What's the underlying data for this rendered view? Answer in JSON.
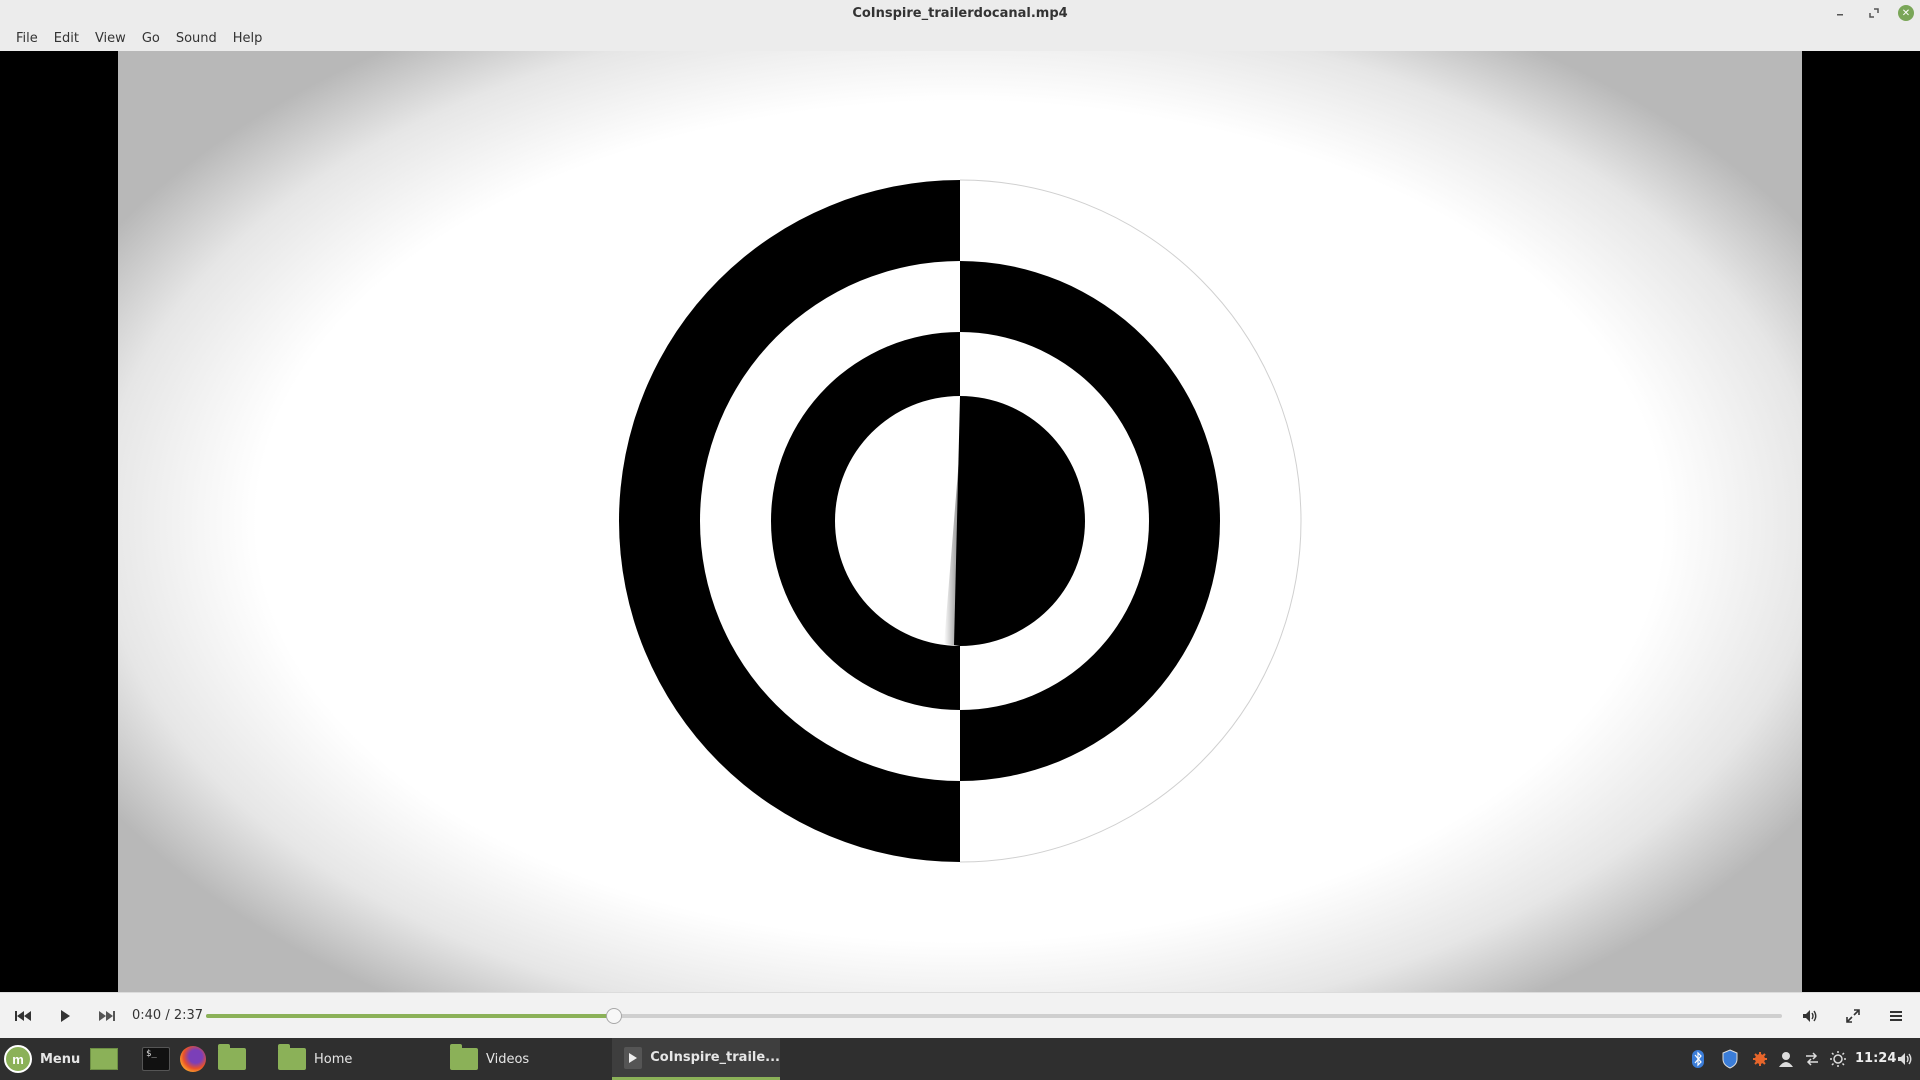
{
  "window": {
    "title": "CoInspire_trailerdocanal.mp4",
    "controls": {
      "minimize_icon": "minimize-icon",
      "maximize_icon": "maximize-icon",
      "close_icon": "close-icon"
    }
  },
  "menubar": {
    "items": [
      {
        "label": "File"
      },
      {
        "label": "Edit"
      },
      {
        "label": "View"
      },
      {
        "label": "Go"
      },
      {
        "label": "Sound"
      },
      {
        "label": "Help"
      }
    ]
  },
  "player": {
    "time": "0:40 / 2:37",
    "progress": 0.259,
    "buttons": {
      "previous_icon": "skip-back-icon",
      "play_icon": "play-icon",
      "next_icon": "skip-forward-icon",
      "volume_icon": "volume-icon",
      "fullscreen_icon": "fullscreen-icon",
      "menu_icon": "hamburger-menu-icon"
    },
    "accent_color": "#8bb158"
  },
  "taskbar": {
    "menu_label": "Menu",
    "launchers": [
      "show-desktop-icon",
      "terminal-icon",
      "firefox-icon",
      "files-icon"
    ],
    "windows": [
      {
        "label": "Home"
      },
      {
        "label": "Videos"
      },
      {
        "label": "CoInspire_traile...",
        "active": true
      }
    ],
    "tray_icons": [
      "bluetooth-icon",
      "shield-icon",
      "update-icon",
      "user-icon",
      "network-icon",
      "brightness-icon"
    ],
    "clock": "11:24",
    "volume_icon": "volume-icon"
  }
}
